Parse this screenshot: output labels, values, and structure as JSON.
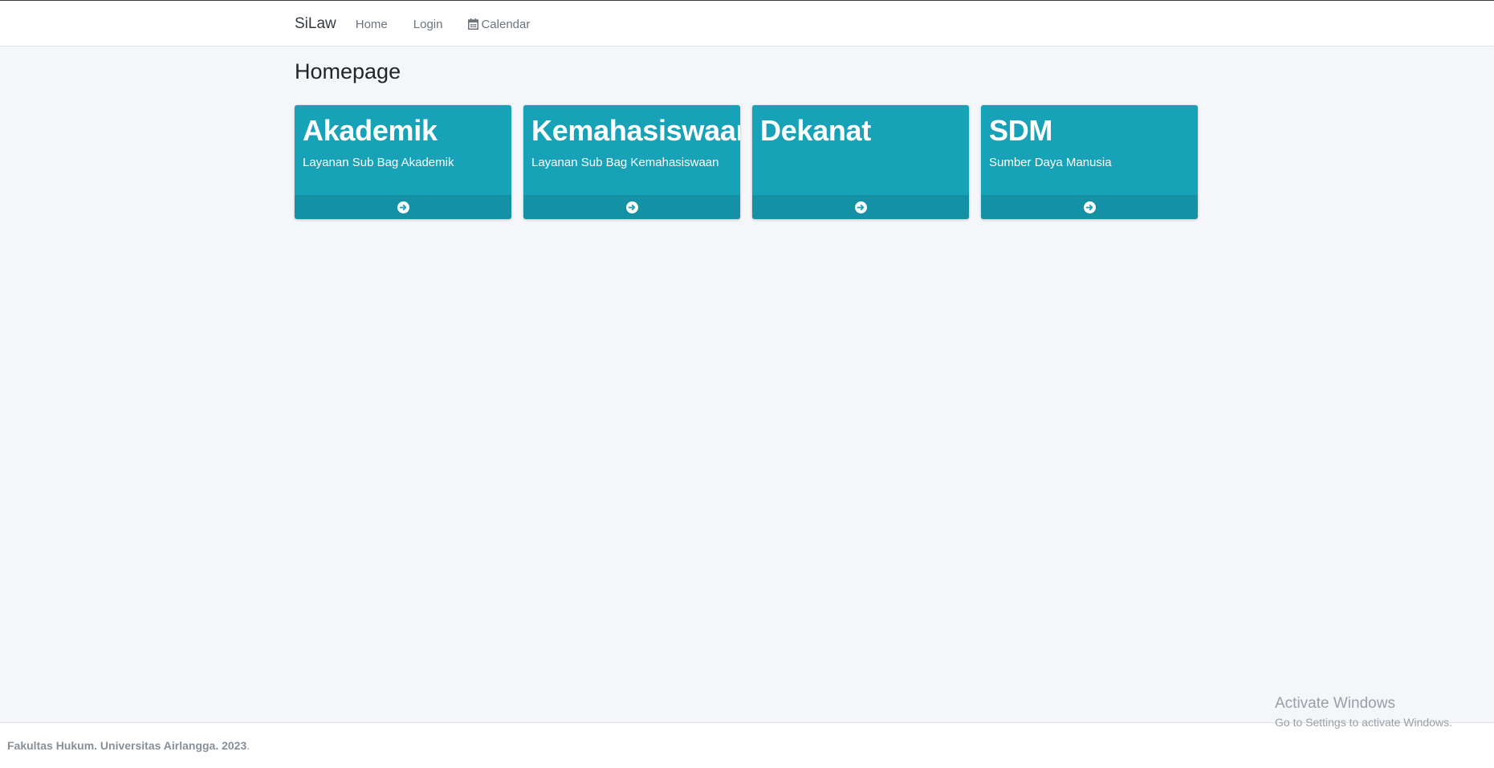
{
  "navbar": {
    "brand": "SiLaw",
    "links": [
      {
        "label": "Home"
      },
      {
        "label": "Login"
      },
      {
        "label": "Calendar",
        "icon": "calendar-icon"
      }
    ]
  },
  "page": {
    "title": "Homepage"
  },
  "cards": [
    {
      "title": "Akademik",
      "subtitle": "Layanan Sub Bag Akademik",
      "icon": "arrow-circle-right-icon"
    },
    {
      "title": "Kemahasiswaan",
      "subtitle": "Layanan Sub Bag Kemahasiswaan",
      "icon": "arrow-circle-right-icon"
    },
    {
      "title": "Dekanat",
      "subtitle": "",
      "icon": "arrow-circle-right-icon"
    },
    {
      "title": "SDM",
      "subtitle": "Sumber Daya Manusia",
      "icon": "arrow-circle-right-icon"
    }
  ],
  "footer": {
    "text": "Fakultas Hukum. Universitas Airlangga. 2023",
    "suffix": "."
  },
  "watermark": {
    "title": "Activate Windows",
    "subtitle": "Go to Settings to activate Windows."
  },
  "colors": {
    "card": "#17a2b8",
    "background": "#f4f6f9",
    "navbar": "#ffffff"
  }
}
